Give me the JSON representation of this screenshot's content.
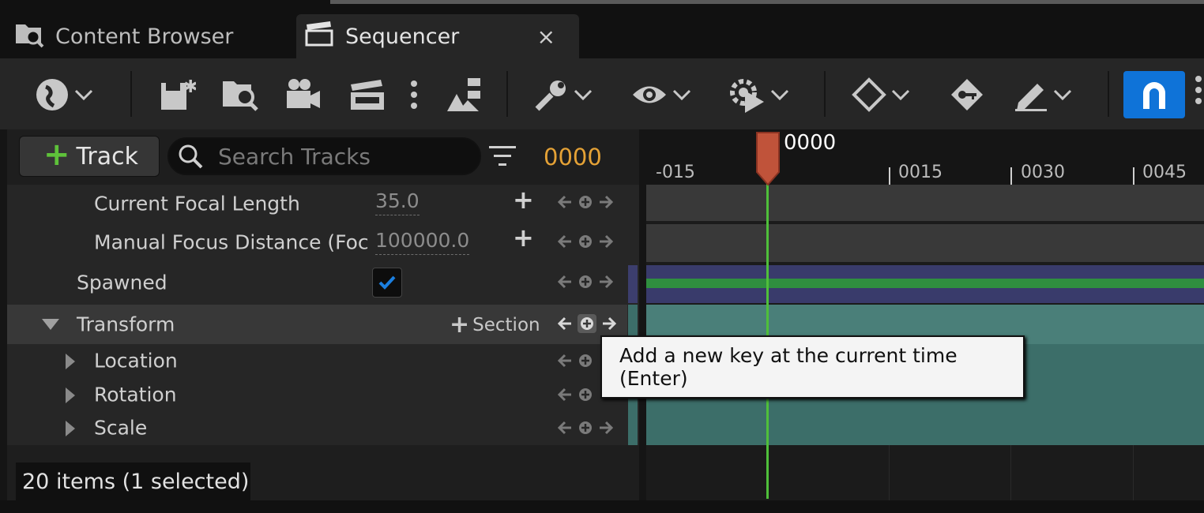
{
  "tabs": [
    {
      "label": "Content Browser",
      "icon": "content-browser-icon"
    },
    {
      "label": "Sequencer",
      "icon": "clapper-icon",
      "close": "×"
    }
  ],
  "toolbar": {
    "icons": [
      "world-icon",
      "save-icon",
      "browse-icon",
      "camera-icon",
      "clapper-icon",
      "more-icon",
      "hierarchy-icon",
      "wrench-icon",
      "eye-icon",
      "gear-play-icon",
      "key-diamond-icon",
      "key-icon",
      "pencil-icon",
      "magnet-icon"
    ],
    "accent": "#0f73d8"
  },
  "track_button": {
    "plus": "+",
    "label": "Track"
  },
  "search": {
    "placeholder": "Search Tracks"
  },
  "timecode": "0000",
  "rows": [
    {
      "label": "Current Focal Length",
      "value": "35.0"
    },
    {
      "label": "Manual Focus Distance (Foc",
      "value": "100000.0"
    },
    {
      "label": "Spawned",
      "checked": true
    },
    {
      "label": "Transform",
      "section_label": "Section"
    },
    {
      "label": "Location"
    },
    {
      "label": "Rotation"
    },
    {
      "label": "Scale"
    }
  ],
  "status": "20 items (1 selected)",
  "ruler": {
    "playhead_label": "0000",
    "ticks": [
      "-015",
      "0015",
      "0030",
      "0045"
    ]
  },
  "tooltip": "Add a new key at the current time (Enter)",
  "colors": {
    "timecode": "#e5a236",
    "playhead": "#c0533a",
    "play_line": "#4fbf3a",
    "lane_spawned": "#393b6b",
    "lane_transform": "#3c6e69"
  }
}
